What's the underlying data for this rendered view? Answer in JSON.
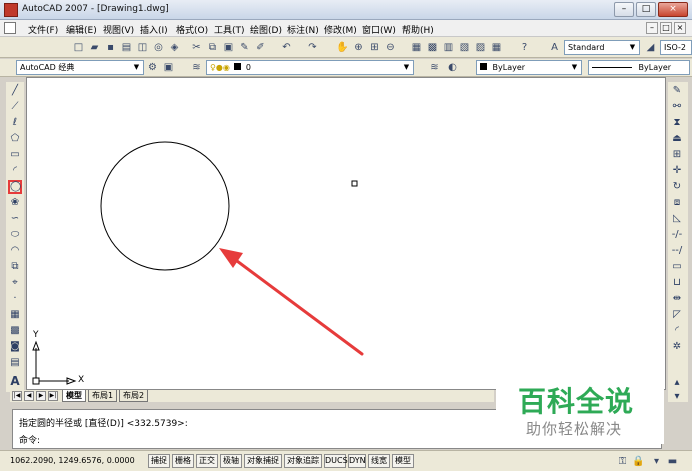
{
  "window": {
    "title": "AutoCAD 2007 - [Drawing1.dwg]",
    "minimize": "–",
    "maximize": "□",
    "close": "×"
  },
  "menu": {
    "items": [
      "文件(F)",
      "编辑(E)",
      "视图(V)",
      "插入(I)",
      "格式(O)",
      "工具(T)",
      "绘图(D)",
      "标注(N)",
      "修改(M)",
      "窗口(W)",
      "帮助(H)"
    ],
    "doc_min": "–",
    "doc_restore": "□",
    "doc_close": "×"
  },
  "toolbar1": {
    "text_style": "Standard",
    "dim_style": "ISO-2"
  },
  "toolbar2": {
    "workspace": "AutoCAD 经典",
    "layer": "0",
    "color": "ByLayer",
    "linetype": "ByLayer"
  },
  "tabs": {
    "nav_first": "|◀",
    "nav_prev": "◀",
    "nav_next": "▶",
    "nav_last": "▶|",
    "items": [
      "模型",
      "布局1",
      "布局2"
    ]
  },
  "ucs": {
    "x_label": "X",
    "y_label": "Y"
  },
  "command": {
    "prompt_line": "指定圆的半径或 [直径(D)] <332.5739>:",
    "input_label": "命令:"
  },
  "status": {
    "coords": "1062.2090,  1249.6576,  0.0000",
    "buttons": [
      "捕捉",
      "栅格",
      "正交",
      "极轴",
      "对象捕捉",
      "对象追踪",
      "DUCS",
      "DYN",
      "线宽",
      "模型"
    ]
  },
  "watermark": {
    "main": "百科全说",
    "sub": "助你轻松解决"
  },
  "colors": {
    "annotation_arrow": "#e63b3b",
    "watermark_green": "#2eaa56",
    "color_swatch": "#000000"
  }
}
